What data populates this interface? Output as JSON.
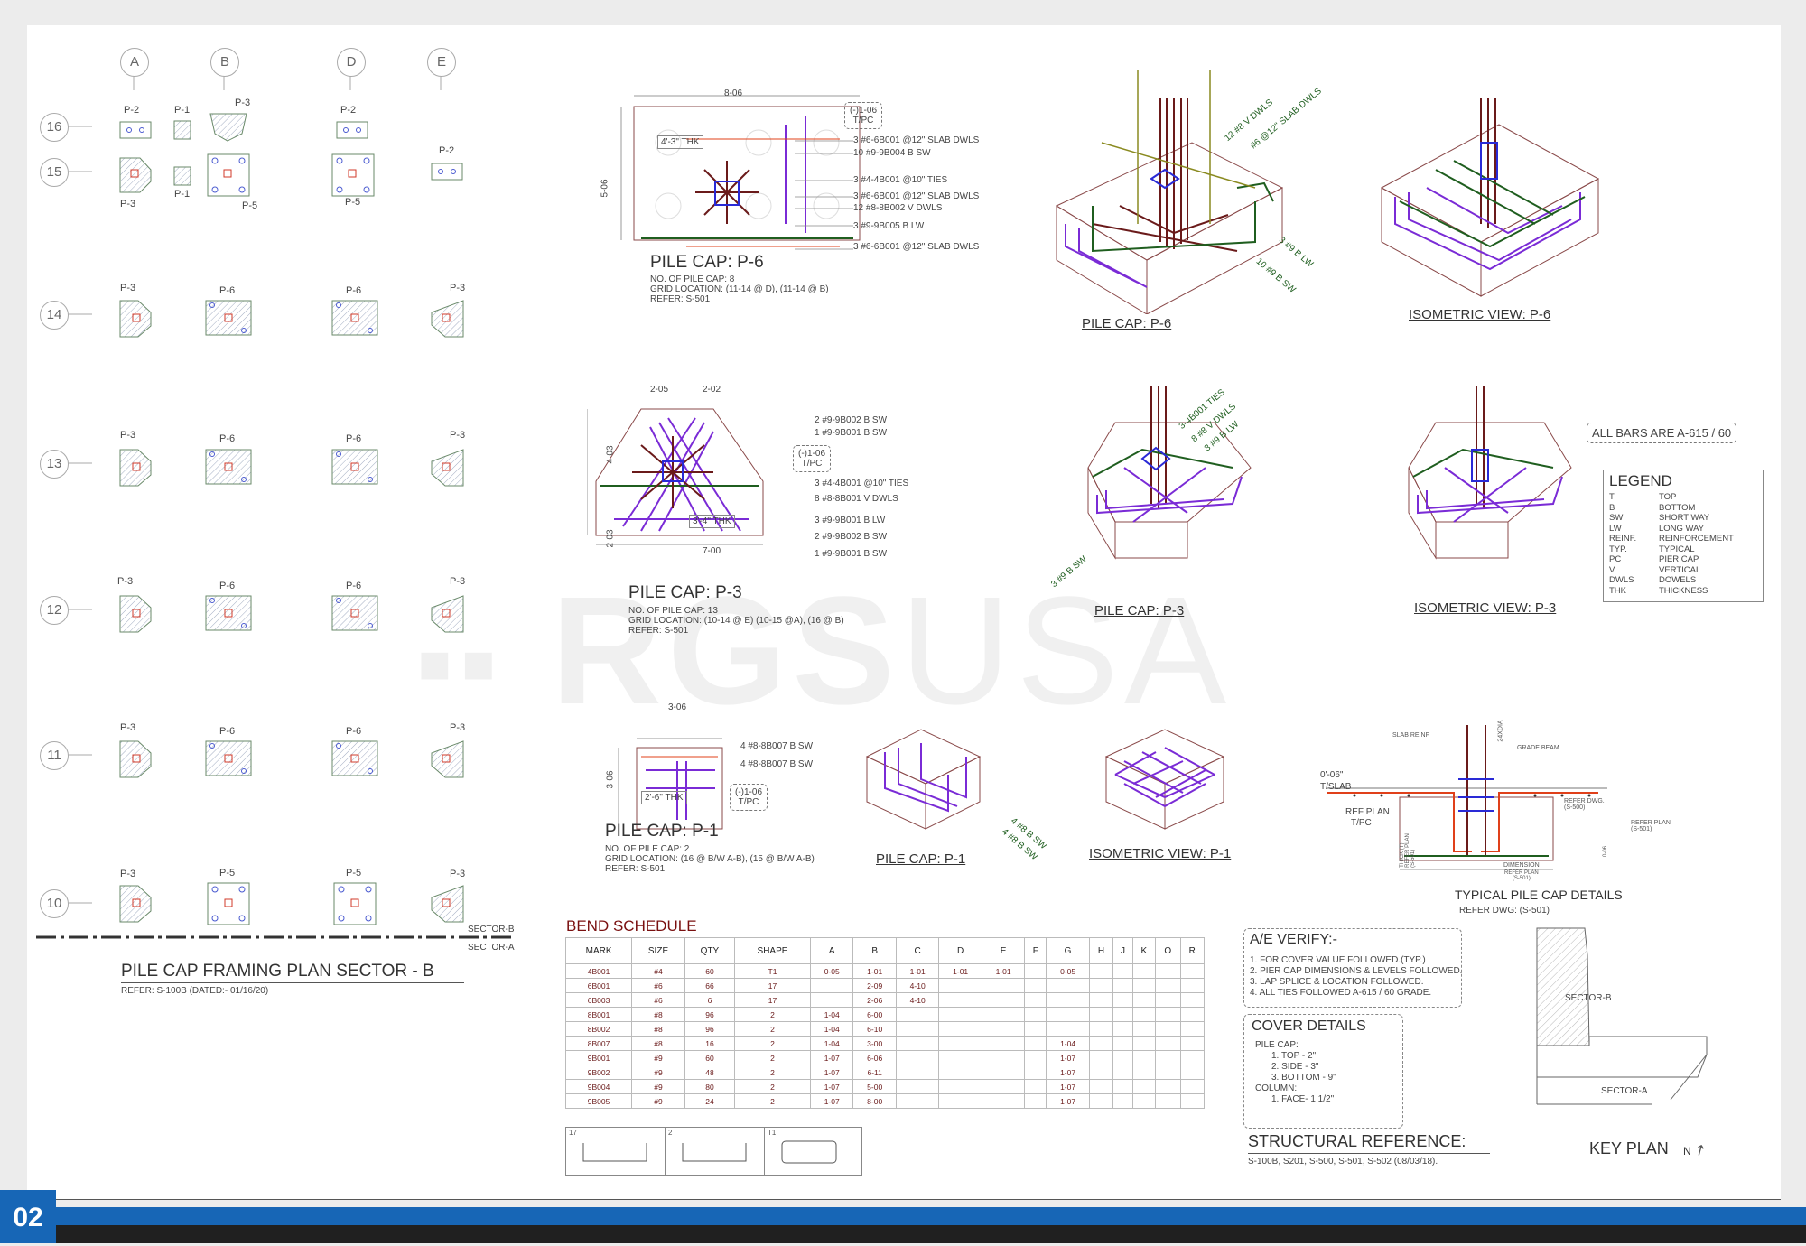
{
  "watermark": {
    "left": "RGS",
    "right": "USA"
  },
  "plan": {
    "columns": [
      "A",
      "B",
      "D",
      "E"
    ],
    "rows": [
      "16",
      "15",
      "14",
      "13",
      "12",
      "11",
      "10"
    ],
    "caps": [
      {
        "label": "P-2"
      },
      {
        "label": "P-1"
      },
      {
        "label": "P-3"
      },
      {
        "label": "P-2"
      },
      {
        "label": "P-3"
      },
      {
        "label": "P-1"
      },
      {
        "label": "P-5"
      },
      {
        "label": "P-5"
      },
      {
        "label": "P-2"
      },
      {
        "label": "P-3"
      },
      {
        "label": "P-6"
      },
      {
        "label": "P-6"
      },
      {
        "label": "P-3"
      },
      {
        "label": "P-3"
      },
      {
        "label": "P-6"
      },
      {
        "label": "P-6"
      },
      {
        "label": "P-3"
      },
      {
        "label": "P-3"
      },
      {
        "label": "P-6"
      },
      {
        "label": "P-6"
      },
      {
        "label": "P-3"
      },
      {
        "label": "P-3"
      },
      {
        "label": "P-6"
      },
      {
        "label": "P-6"
      },
      {
        "label": "P-3"
      },
      {
        "label": "P-3"
      },
      {
        "label": "P-5"
      },
      {
        "label": "P-5"
      },
      {
        "label": "P-3"
      }
    ],
    "sector_b": "SECTOR-B",
    "sector_a": "SECTOR-A",
    "title": "PILE CAP FRAMING PLAN SECTOR - B",
    "refer": "REFER: S-100B (DATED:- 01/16/20)"
  },
  "p6": {
    "dim_top": "8-06",
    "dim_side": "5-06",
    "thk": "4'-3\" THK",
    "callout": "(-)1-06\nT/PC",
    "notes": [
      "3 #6-6B001 @12\" SLAB DWLS",
      "10 #9-9B004 B SW",
      "3 #4-4B001 @10\" TIES",
      "3 #6-6B001 @12\" SLAB DWLS",
      "12 #8-8B002 V DWLS",
      "3 #9-9B005 B LW",
      "3 #6-6B001 @12\" SLAB DWLS"
    ],
    "title": "PILE CAP: P-6",
    "info": [
      "NO. OF PILE CAP: 8",
      "GRID LOCATION: (11-14 @ D), (11-14 @ B)",
      "REFER: S-501"
    ],
    "iso_notes": [
      "12 #8 V DWLS",
      "#6 @12\" SLAB DWLS",
      "3 #9 B LW",
      "10 #9 B SW"
    ],
    "iso_title": "PILE CAP: P-6",
    "iso_view_title": "ISOMETRIC VIEW: P-6"
  },
  "p3": {
    "dim_top_a": "2-05",
    "dim_top_b": "2-02",
    "dim_side_a": "4-03",
    "dim_side_b": "2-03",
    "dim_bottom": "7-00",
    "thk": "3'-4\" THK",
    "callout": "(-)1-06\nT/PC",
    "notes": [
      "2 #9-9B002 B SW",
      "1 #9-9B001 B SW",
      "3 #4-4B001 @10\" TIES",
      "8 #8-8B001 V DWLS",
      "3 #9-9B001 B LW",
      "2 #9-9B002 B SW",
      "1 #9-9B001 B SW"
    ],
    "title": "PILE CAP: P-3",
    "info": [
      "NO. OF PILE CAP: 13",
      "GRID LOCATION: (10-14 @ E) (10-15 @A), (16 @ B)",
      "REFER: S-501"
    ],
    "iso_notes": [
      "3-4B001 TIES",
      "8 #8 V DWLS",
      "3 #9 B LW",
      "3 #9 B SW"
    ],
    "iso_title": "PILE CAP: P-3",
    "iso_view_title": "ISOMETRIC VIEW: P-3"
  },
  "p1": {
    "dim_top": "3-06",
    "dim_side": "3-06",
    "thk": "2'-6\" THK",
    "callout": "(-)1-06\nT/PC",
    "notes": [
      "4 #8-8B007 B SW",
      "4 #8-8B007 B SW"
    ],
    "title": "PILE CAP: P-1",
    "info": [
      "NO. OF PILE CAP: 2",
      "GRID LOCATION: (16 @ B/W A-B), (15 @ B/W A-B)",
      "REFER: S-501"
    ],
    "iso_notes": [
      "4 #8 B SW",
      "4 #8 B SW"
    ],
    "iso_title": "PILE CAP: P-1",
    "iso_view_title": "ISOMETRIC VIEW: P-1"
  },
  "all_bars": "ALL BARS ARE A-615 / 60",
  "legend": {
    "title": "LEGEND",
    "items": [
      {
        "k": "T",
        "v": "TOP"
      },
      {
        "k": "B",
        "v": "BOTTOM"
      },
      {
        "k": "SW",
        "v": "SHORT WAY"
      },
      {
        "k": "LW",
        "v": "LONG WAY"
      },
      {
        "k": "REINF.",
        "v": "REINFORCEMENT"
      },
      {
        "k": "TYP.",
        "v": "TYPICAL"
      },
      {
        "k": "PC",
        "v": "PIER CAP"
      },
      {
        "k": "V",
        "v": "VERTICAL"
      },
      {
        "k": "DWLS",
        "v": "DOWELS"
      },
      {
        "k": "THK",
        "v": "THICKNESS"
      }
    ]
  },
  "typical": {
    "title": "TYPICAL PILE CAP DETAILS",
    "refer": "REFER DWG: (S-501)",
    "labels": {
      "slab": "SLAB REINF",
      "grade": "GRADE BEAM",
      "elev": "0'-06\"",
      "tslab": "T/SLAB",
      "refplan": "REF PLAN",
      "tpc": "T/PC",
      "refer_dwg": "REFER DWG.\n(S-500)",
      "refer_plan": "REFER PLAN\n(S-501)",
      "dimension": "DIMENSION",
      "refer_plan2": "REFER PLAN\n(S-501)",
      "top_dim": "24XDIA",
      "thick": "THICK (T)\nREFER PLAN\n(S-501)",
      "cov": "0-06"
    }
  },
  "bend": {
    "title": "BEND SCHEDULE",
    "headers": [
      "MARK",
      "SIZE",
      "QTY",
      "SHAPE",
      "A",
      "B",
      "C",
      "D",
      "E",
      "F",
      "G",
      "H",
      "J",
      "K",
      "O",
      "R"
    ],
    "rows": [
      [
        "4B001",
        "#4",
        "60",
        "T1",
        "0-05",
        "1-01",
        "1-01",
        "1-01",
        "1-01",
        "",
        "0-05",
        "",
        "",
        "",
        "",
        ""
      ],
      [
        "6B001",
        "#6",
        "66",
        "17",
        "",
        "2-09",
        "4-10",
        "",
        "",
        "",
        "",
        "",
        "",
        "",
        "",
        ""
      ],
      [
        "6B003",
        "#6",
        "6",
        "17",
        "",
        "2-06",
        "4-10",
        "",
        "",
        "",
        "",
        "",
        "",
        "",
        "",
        ""
      ],
      [
        "8B001",
        "#8",
        "96",
        "2",
        "1-04",
        "6-00",
        "",
        "",
        "",
        "",
        "",
        "",
        "",
        "",
        "",
        ""
      ],
      [
        "8B002",
        "#8",
        "96",
        "2",
        "1-04",
        "6-10",
        "",
        "",
        "",
        "",
        "",
        "",
        "",
        "",
        "",
        ""
      ],
      [
        "8B007",
        "#8",
        "16",
        "2",
        "1-04",
        "3-00",
        "",
        "",
        "",
        "",
        "1-04",
        "",
        "",
        "",
        "",
        ""
      ],
      [
        "9B001",
        "#9",
        "60",
        "2",
        "1-07",
        "6-06",
        "",
        "",
        "",
        "",
        "1-07",
        "",
        "",
        "",
        "",
        ""
      ],
      [
        "9B002",
        "#9",
        "48",
        "2",
        "1-07",
        "6-11",
        "",
        "",
        "",
        "",
        "1-07",
        "",
        "",
        "",
        "",
        ""
      ],
      [
        "9B004",
        "#9",
        "80",
        "2",
        "1-07",
        "5-00",
        "",
        "",
        "",
        "",
        "1-07",
        "",
        "",
        "",
        "",
        ""
      ],
      [
        "9B005",
        "#9",
        "24",
        "2",
        "1-07",
        "8-00",
        "",
        "",
        "",
        "",
        "1-07",
        "",
        "",
        "",
        "",
        ""
      ]
    ],
    "shapes": [
      "17",
      "2",
      "T1"
    ]
  },
  "ae": {
    "title": "A/E VERIFY:-",
    "items": [
      "1. FOR COVER VALUE FOLLOWED.(TYP.)",
      "2. PIER CAP DIMENSIONS & LEVELS FOLLOWED.",
      "3. LAP SPLICE & LOCATION FOLLOWED.",
      "4. ALL TIES FOLLOWED A-615 / 60 GRADE."
    ]
  },
  "cover": {
    "title": "COVER DETAILS",
    "items": [
      "PILE CAP:",
      "1. TOP - 2\"",
      "2. SIDE - 3\"",
      "3. BOTTOM - 9\"",
      "COLUMN:",
      "1. FACE- 1 1/2\""
    ]
  },
  "structural": {
    "title": "STRUCTURAL REFERENCE:",
    "text": "S-100B, S201, S-500, S-501, S-502 (08/03/18)."
  },
  "keyplan": {
    "title": "KEY PLAN",
    "sector_b": "SECTOR-B",
    "sector_a": "SECTOR-A",
    "north": "N"
  },
  "page_number": "02",
  "colors": {
    "purple": "#7a2bd6",
    "darkred": "#6a1a1a",
    "green": "#1f5e1f",
    "red": "#e0401a",
    "blue": "#2a2ad6",
    "footer": "#1766b6"
  }
}
